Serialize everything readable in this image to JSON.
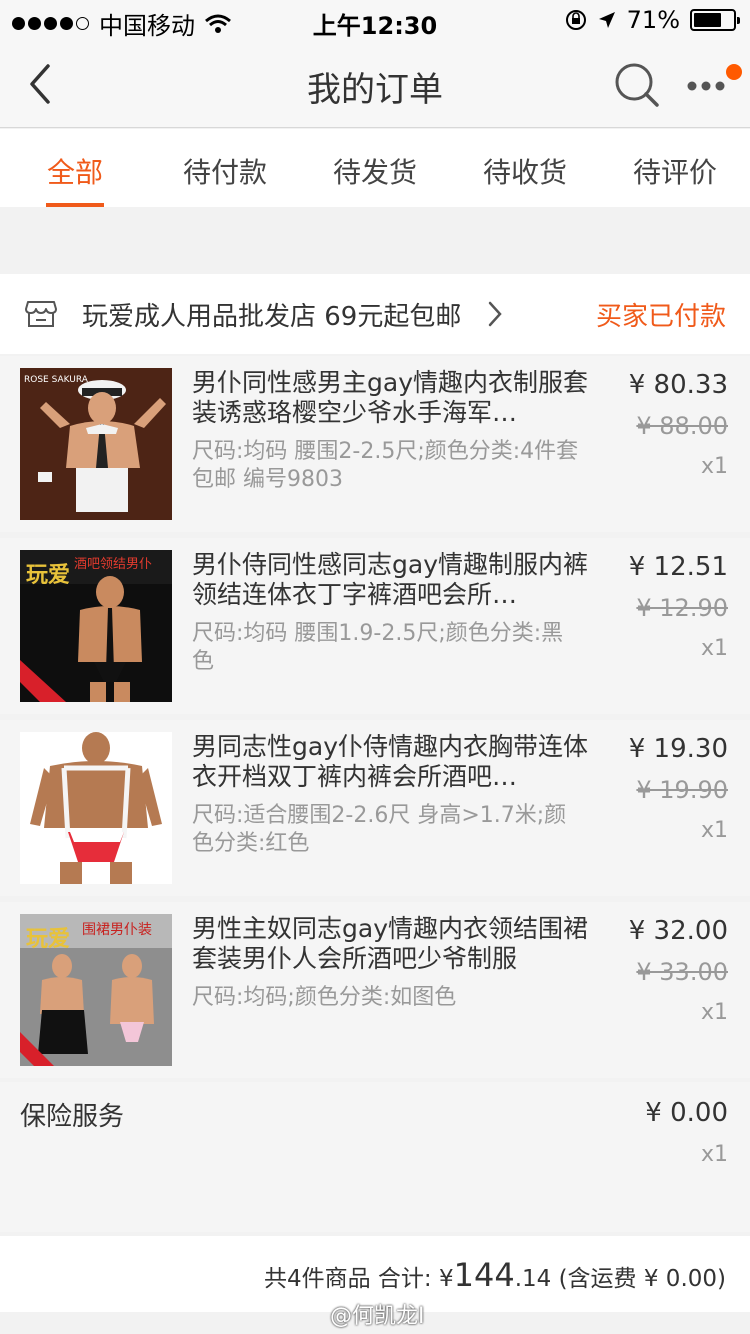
{
  "status_bar": {
    "carrier": "中国移动",
    "time": "上午12:30",
    "battery_percent": "71%",
    "battery_level": 0.71
  },
  "nav": {
    "title": "我的订单"
  },
  "tabs": [
    "全部",
    "待付款",
    "待发货",
    "待收货",
    "待评价"
  ],
  "active_tab": "全部",
  "shop": {
    "name": "玩爱成人用品批发店 69元起包邮",
    "status": "买家已付款"
  },
  "items": [
    {
      "title": "男仆同性感男主gay情趣内衣制服套装诱惑珞樱空少爷水手海军…",
      "spec": "尺码:均码 腰围2-2.5尺;颜色分类:4件套 包邮 编号9803",
      "price": "¥ 80.33",
      "orig_price": "¥ 88.00",
      "qty": "x1",
      "thumb_label": "ROSE SAKURA"
    },
    {
      "title": "男仆侍同性感同志gay情趣制服内裤领结连体衣丁字裤酒吧会所…",
      "spec": "尺码:均码 腰围1.9-2.5尺;颜色分类:黑色",
      "price": "¥ 12.51",
      "orig_price": "¥ 12.90",
      "qty": "x1",
      "thumb_label": "玩爱",
      "thumb_sub": "酒吧领结男仆"
    },
    {
      "title": "男同志性gay仆侍情趣内衣胸带连体衣开档双丁裤内裤会所酒吧…",
      "spec": "尺码:适合腰围2-2.6尺 身高>1.7米;颜色分类:红色",
      "price": "¥ 19.30",
      "orig_price": "¥ 19.90",
      "qty": "x1"
    },
    {
      "title": "男性主奴同志gay情趣内衣领结围裙套装男仆人会所酒吧少爷制服",
      "spec": "尺码:均码;颜色分类:如图色",
      "price": "¥ 32.00",
      "orig_price": "¥ 33.00",
      "qty": "x1",
      "thumb_label": "玩爱",
      "thumb_sub": "围裙男仆装"
    }
  ],
  "insurance": {
    "label": "保险服务",
    "price": "¥ 0.00",
    "qty": "x1"
  },
  "summary": {
    "count_text": "共4件商品 合计:",
    "currency": "¥",
    "total_int": "144",
    "total_dec": ".14",
    "shipping": "(含运费 ¥ 0.00)"
  },
  "watermark": "@何凯龙I",
  "colors": {
    "accent": "#f05a1a",
    "badge": "#ff5a00"
  }
}
